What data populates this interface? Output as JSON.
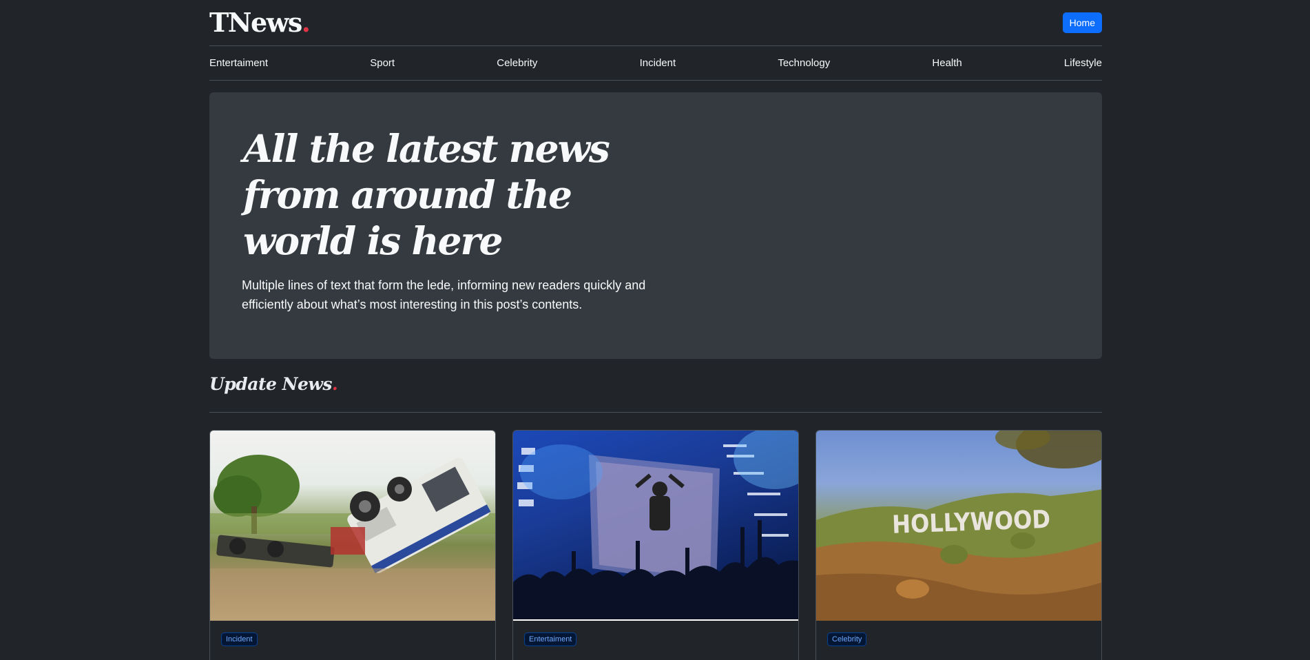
{
  "header": {
    "brand": "TNews",
    "brand_dot": ".",
    "home_label": "Home"
  },
  "nav": {
    "items": [
      {
        "label": "Entertaiment"
      },
      {
        "label": "Sport"
      },
      {
        "label": "Celebrity"
      },
      {
        "label": "Incident"
      },
      {
        "label": "Technology"
      },
      {
        "label": "Health"
      },
      {
        "label": "Lifestyle"
      }
    ]
  },
  "hero": {
    "title": "All the latest news from around the world is here",
    "lede": "Multiple lines of text that form the lede, informing new readers quickly and efficiently about what’s most interesting in this post’s contents."
  },
  "section": {
    "title": "Update News",
    "title_dot": "."
  },
  "cards": [
    {
      "badge": "Incident",
      "image": "overturned-truck-photo"
    },
    {
      "badge": "Entertaiment",
      "image": "concert-crowd-photo"
    },
    {
      "badge": "Celebrity",
      "image": "hollywood-sign-photo",
      "sign_text": "HOLLYWOOD"
    }
  ],
  "colors": {
    "background": "#212529",
    "hero_bg": "#343a40",
    "accent_red": "#dc3545",
    "button_blue": "#0d6efd"
  }
}
